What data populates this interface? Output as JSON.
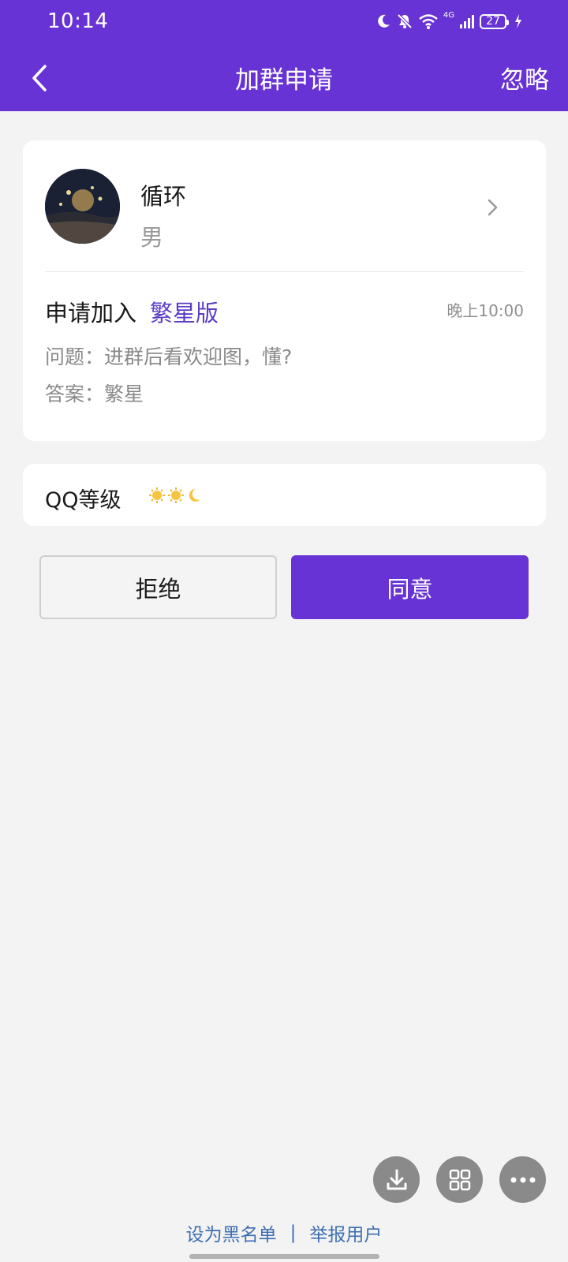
{
  "status_bar": {
    "time": "10:14",
    "network": "4G",
    "battery": "27"
  },
  "header": {
    "title": "加群申请",
    "ignore_label": "忽略"
  },
  "applicant": {
    "name": "循环",
    "gender": "男"
  },
  "request": {
    "prefix": "申请加入",
    "group_name": "繁星版",
    "time": "晚上10:00",
    "question": "问题：进群后看欢迎图，懂?",
    "answer": "答案：繁星"
  },
  "qq_level": {
    "label": "QQ等级",
    "icons": [
      "sun-icon",
      "sun-icon",
      "moon-icon"
    ]
  },
  "actions": {
    "reject_label": "拒绝",
    "accept_label": "同意"
  },
  "footer": {
    "blacklist_label": "设为黑名单",
    "separator": "|",
    "report_label": "举报用户"
  },
  "colors": {
    "accent": "#6733d4",
    "link": "#3e6fb1",
    "background": "#f3f3f3"
  }
}
